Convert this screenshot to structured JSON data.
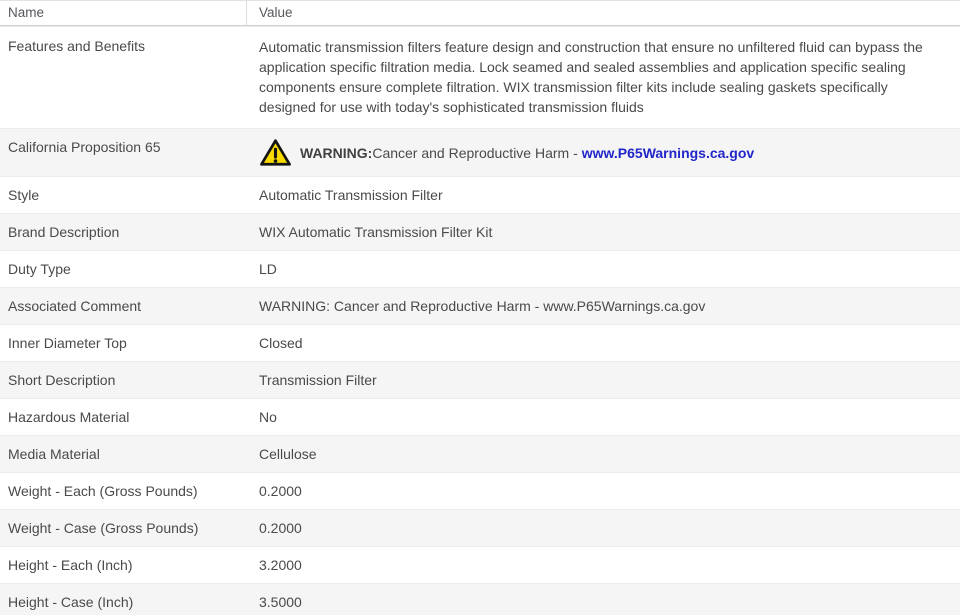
{
  "header": {
    "name_col": "Name",
    "value_col": "Value"
  },
  "rows": [
    {
      "name": "Features and Benefits",
      "value": "Automatic transmission filters feature design and construction that ensure no unfiltered fluid can bypass the application specific filtration media. Lock seamed and sealed assemblies and application specific sealing components ensure complete filtration. WIX transmission filter kits include sealing gaskets specifically designed for use with today's sophisticated transmission fluids"
    },
    {
      "name": "California Proposition 65",
      "warning": {
        "bold": "WARNING:",
        "text": " Cancer and Reproductive Harm - ",
        "link": "www.P65Warnings.ca.gov"
      }
    },
    {
      "name": "Style",
      "value": "Automatic Transmission Filter"
    },
    {
      "name": "Brand Description",
      "value": "WIX Automatic Transmission Filter Kit"
    },
    {
      "name": "Duty Type",
      "value": "LD"
    },
    {
      "name": "Associated Comment",
      "value": "WARNING: Cancer and Reproductive Harm - www.P65Warnings.ca.gov"
    },
    {
      "name": "Inner Diameter Top",
      "value": "Closed"
    },
    {
      "name": "Short Description",
      "value": "Transmission Filter"
    },
    {
      "name": "Hazardous Material",
      "value": "No"
    },
    {
      "name": "Media Material",
      "value": "Cellulose"
    },
    {
      "name": "Weight - Each (Gross Pounds)",
      "value": "0.2000"
    },
    {
      "name": "Weight - Case (Gross Pounds)",
      "value": "0.2000"
    },
    {
      "name": "Height - Each (Inch)",
      "value": "3.2000"
    },
    {
      "name": "Height - Case (Inch)",
      "value": "3.5000"
    }
  ],
  "colors": {
    "stripe": "#f5f5f5",
    "link_blue": "#2126c9",
    "warning_yellow": "#f8da00",
    "body_text": "#4a4a4c"
  }
}
